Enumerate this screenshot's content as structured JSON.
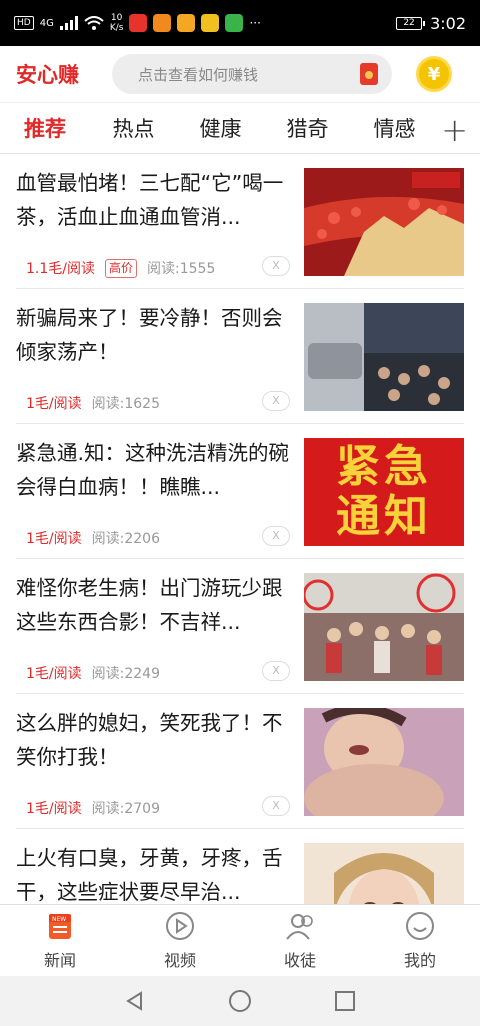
{
  "status_bar": {
    "network": "HD",
    "signal": "4G",
    "speed_value": "10",
    "speed_unit": "K/s",
    "battery": "22",
    "time": "3:02"
  },
  "app": {
    "logo": "安心赚",
    "search_placeholder": "点击查看如何赚钱",
    "coin_symbol": "¥",
    "accent_color": "#e02a2a"
  },
  "tabs": [
    {
      "label": "推荐",
      "active": true
    },
    {
      "label": "热点",
      "active": false
    },
    {
      "label": "健康",
      "active": false
    },
    {
      "label": "猎奇",
      "active": false
    },
    {
      "label": "情感",
      "active": false
    }
  ],
  "tab_add": "+",
  "articles": [
    {
      "title": "血管最怕堵！三七配“它”喝一茶，活血止血通血管消...",
      "price": "1.1毛/阅读",
      "badge": "高价",
      "reads": "阅读:1555",
      "close": "X"
    },
    {
      "title": "新骗局来了！要冷静！否则会倾家荡产！",
      "price": "1毛/阅读",
      "reads": "阅读:1625",
      "close": "X"
    },
    {
      "title": "紧急通.知：这种洗洁精洗的碗会得白血病！！瞧瞧...",
      "price": "1毛/阅读",
      "reads": "阅读:2206",
      "close": "X",
      "thumb_text": [
        "紧急",
        "通知"
      ]
    },
    {
      "title": "难怪你老生病！出门游玩少跟这些东西合影！不吉祥...",
      "price": "1毛/阅读",
      "reads": "阅读:2249",
      "close": "X"
    },
    {
      "title": "这么胖的媳妇，笑死我了！不笑你打我！",
      "price": "1毛/阅读",
      "reads": "阅读:2709",
      "close": "X"
    },
    {
      "title": "上火有口臭，牙黄，牙疼，舌干，这些症状要尽早治...",
      "price": "",
      "reads": "",
      "close": ""
    }
  ],
  "bottom_nav": [
    {
      "label": "新闻",
      "icon": "news-icon"
    },
    {
      "label": "视频",
      "icon": "play-icon"
    },
    {
      "label": "收徒",
      "icon": "users-icon"
    },
    {
      "label": "我的",
      "icon": "profile-icon"
    }
  ]
}
